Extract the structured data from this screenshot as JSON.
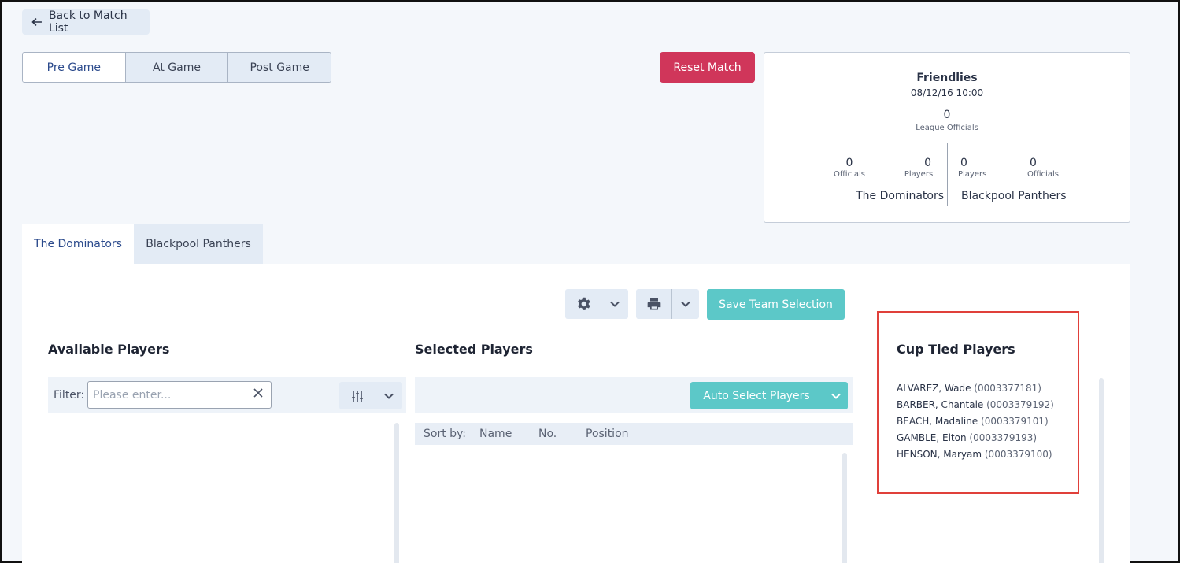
{
  "nav": {
    "back_label": "Back to Match List"
  },
  "phase_tabs": [
    {
      "label": "Pre Game",
      "active": true
    },
    {
      "label": "At Game",
      "active": false
    },
    {
      "label": "Post Game",
      "active": false
    }
  ],
  "reset_label": "Reset Match",
  "match": {
    "competition": "Friendlies",
    "datetime": "08/12/16 10:00",
    "league_officials_count": "0",
    "league_officials_label": "League Officials",
    "home": {
      "name": "The Dominators",
      "officials_count": "0",
      "officials_label": "Officials",
      "players_count": "0",
      "players_label": "Players"
    },
    "away": {
      "name": "Blackpool Panthers",
      "players_count": "0",
      "players_label": "Players",
      "officials_count": "0",
      "officials_label": "Officials"
    }
  },
  "team_tabs": [
    {
      "label": "The Dominators",
      "active": true
    },
    {
      "label": "Blackpool Panthers",
      "active": false
    }
  ],
  "toolbar": {
    "save_label": "Save Team Selection"
  },
  "available": {
    "title": "Available Players",
    "filter_label": "Filter:",
    "filter_placeholder": "Please enter..."
  },
  "selected": {
    "title": "Selected Players",
    "auto_select_label": "Auto Select Players",
    "sort_label": "Sort by:",
    "sort_columns": [
      "Name",
      "No.",
      "Position"
    ]
  },
  "cup_tied": {
    "title": "Cup Tied Players",
    "players": [
      {
        "name": "ALVAREZ, Wade",
        "id": "(0003377181)"
      },
      {
        "name": "BARBER, Chantale",
        "id": "(0003379192)"
      },
      {
        "name": "BEACH, Madaline",
        "id": "(0003379101)"
      },
      {
        "name": "GAMBLE, Elton",
        "id": "(0003379193)"
      },
      {
        "name": "HENSON, Maryam",
        "id": "(0003379100)"
      }
    ]
  },
  "colors": {
    "reset": "#d0365a",
    "teal": "#5cc8c8",
    "highlight_box": "#e0403a",
    "active_tab_text": "#2b4a8c"
  }
}
